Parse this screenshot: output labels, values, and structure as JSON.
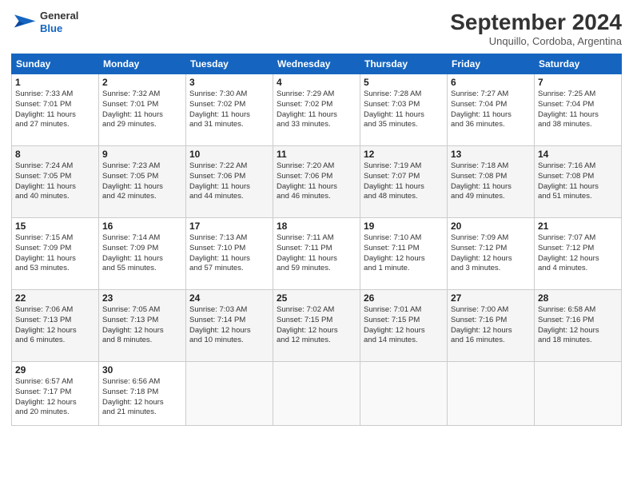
{
  "header": {
    "logo_line1": "General",
    "logo_line2": "Blue",
    "title": "September 2024",
    "subtitle": "Unquillo, Cordoba, Argentina"
  },
  "days_of_week": [
    "Sunday",
    "Monday",
    "Tuesday",
    "Wednesday",
    "Thursday",
    "Friday",
    "Saturday"
  ],
  "weeks": [
    [
      {
        "day": "1",
        "info": "Sunrise: 7:33 AM\nSunset: 7:01 PM\nDaylight: 11 hours\nand 27 minutes."
      },
      {
        "day": "2",
        "info": "Sunrise: 7:32 AM\nSunset: 7:01 PM\nDaylight: 11 hours\nand 29 minutes."
      },
      {
        "day": "3",
        "info": "Sunrise: 7:30 AM\nSunset: 7:02 PM\nDaylight: 11 hours\nand 31 minutes."
      },
      {
        "day": "4",
        "info": "Sunrise: 7:29 AM\nSunset: 7:02 PM\nDaylight: 11 hours\nand 33 minutes."
      },
      {
        "day": "5",
        "info": "Sunrise: 7:28 AM\nSunset: 7:03 PM\nDaylight: 11 hours\nand 35 minutes."
      },
      {
        "day": "6",
        "info": "Sunrise: 7:27 AM\nSunset: 7:04 PM\nDaylight: 11 hours\nand 36 minutes."
      },
      {
        "day": "7",
        "info": "Sunrise: 7:25 AM\nSunset: 7:04 PM\nDaylight: 11 hours\nand 38 minutes."
      }
    ],
    [
      {
        "day": "8",
        "info": "Sunrise: 7:24 AM\nSunset: 7:05 PM\nDaylight: 11 hours\nand 40 minutes."
      },
      {
        "day": "9",
        "info": "Sunrise: 7:23 AM\nSunset: 7:05 PM\nDaylight: 11 hours\nand 42 minutes."
      },
      {
        "day": "10",
        "info": "Sunrise: 7:22 AM\nSunset: 7:06 PM\nDaylight: 11 hours\nand 44 minutes."
      },
      {
        "day": "11",
        "info": "Sunrise: 7:20 AM\nSunset: 7:06 PM\nDaylight: 11 hours\nand 46 minutes."
      },
      {
        "day": "12",
        "info": "Sunrise: 7:19 AM\nSunset: 7:07 PM\nDaylight: 11 hours\nand 48 minutes."
      },
      {
        "day": "13",
        "info": "Sunrise: 7:18 AM\nSunset: 7:08 PM\nDaylight: 11 hours\nand 49 minutes."
      },
      {
        "day": "14",
        "info": "Sunrise: 7:16 AM\nSunset: 7:08 PM\nDaylight: 11 hours\nand 51 minutes."
      }
    ],
    [
      {
        "day": "15",
        "info": "Sunrise: 7:15 AM\nSunset: 7:09 PM\nDaylight: 11 hours\nand 53 minutes."
      },
      {
        "day": "16",
        "info": "Sunrise: 7:14 AM\nSunset: 7:09 PM\nDaylight: 11 hours\nand 55 minutes."
      },
      {
        "day": "17",
        "info": "Sunrise: 7:13 AM\nSunset: 7:10 PM\nDaylight: 11 hours\nand 57 minutes."
      },
      {
        "day": "18",
        "info": "Sunrise: 7:11 AM\nSunset: 7:11 PM\nDaylight: 11 hours\nand 59 minutes."
      },
      {
        "day": "19",
        "info": "Sunrise: 7:10 AM\nSunset: 7:11 PM\nDaylight: 12 hours\nand 1 minute."
      },
      {
        "day": "20",
        "info": "Sunrise: 7:09 AM\nSunset: 7:12 PM\nDaylight: 12 hours\nand 3 minutes."
      },
      {
        "day": "21",
        "info": "Sunrise: 7:07 AM\nSunset: 7:12 PM\nDaylight: 12 hours\nand 4 minutes."
      }
    ],
    [
      {
        "day": "22",
        "info": "Sunrise: 7:06 AM\nSunset: 7:13 PM\nDaylight: 12 hours\nand 6 minutes."
      },
      {
        "day": "23",
        "info": "Sunrise: 7:05 AM\nSunset: 7:13 PM\nDaylight: 12 hours\nand 8 minutes."
      },
      {
        "day": "24",
        "info": "Sunrise: 7:03 AM\nSunset: 7:14 PM\nDaylight: 12 hours\nand 10 minutes."
      },
      {
        "day": "25",
        "info": "Sunrise: 7:02 AM\nSunset: 7:15 PM\nDaylight: 12 hours\nand 12 minutes."
      },
      {
        "day": "26",
        "info": "Sunrise: 7:01 AM\nSunset: 7:15 PM\nDaylight: 12 hours\nand 14 minutes."
      },
      {
        "day": "27",
        "info": "Sunrise: 7:00 AM\nSunset: 7:16 PM\nDaylight: 12 hours\nand 16 minutes."
      },
      {
        "day": "28",
        "info": "Sunrise: 6:58 AM\nSunset: 7:16 PM\nDaylight: 12 hours\nand 18 minutes."
      }
    ],
    [
      {
        "day": "29",
        "info": "Sunrise: 6:57 AM\nSunset: 7:17 PM\nDaylight: 12 hours\nand 20 minutes."
      },
      {
        "day": "30",
        "info": "Sunrise: 6:56 AM\nSunset: 7:18 PM\nDaylight: 12 hours\nand 21 minutes."
      },
      {
        "day": "",
        "info": ""
      },
      {
        "day": "",
        "info": ""
      },
      {
        "day": "",
        "info": ""
      },
      {
        "day": "",
        "info": ""
      },
      {
        "day": "",
        "info": ""
      }
    ]
  ]
}
